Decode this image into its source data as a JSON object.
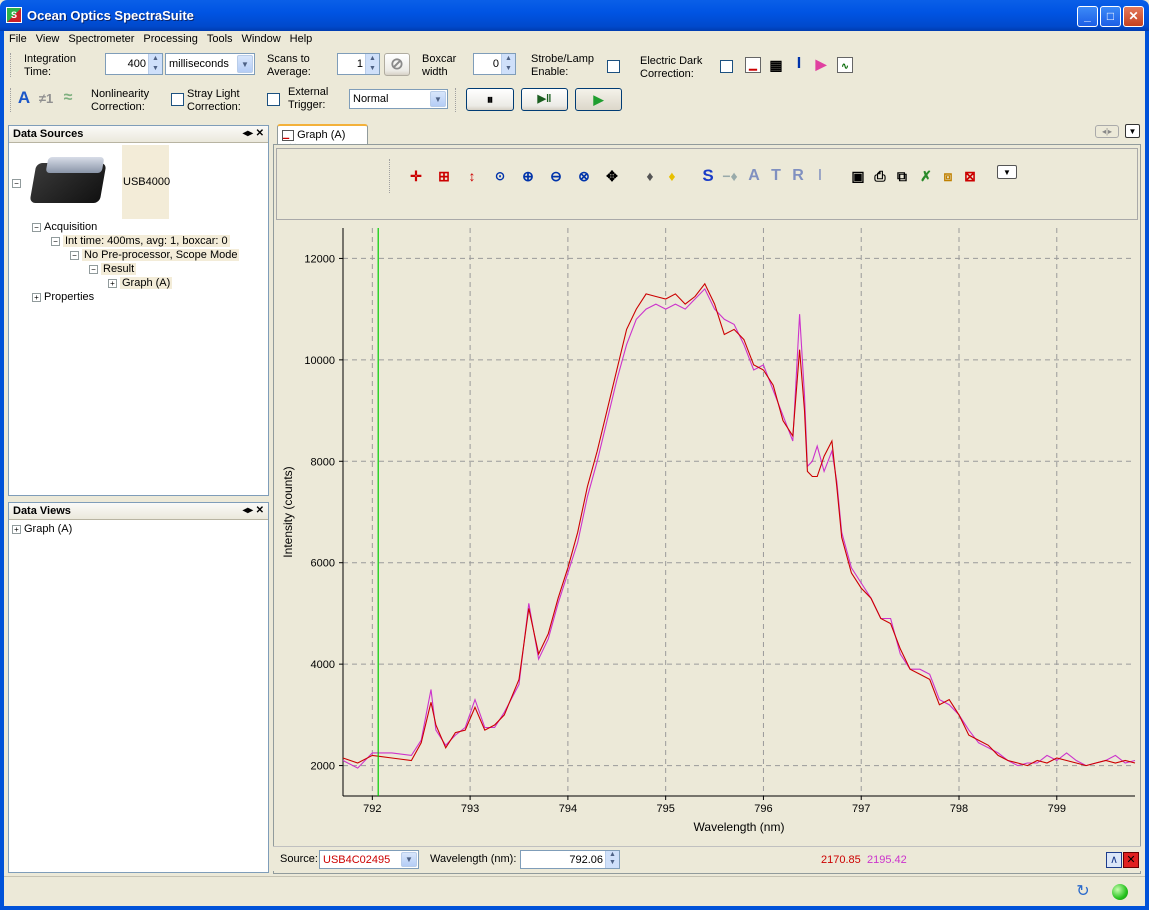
{
  "window": {
    "title": "Ocean Optics SpectraSuite",
    "minimize": "_",
    "maximize": "□",
    "close": "✕"
  },
  "menu": [
    "File",
    "View",
    "Spectrometer",
    "Processing",
    "Tools",
    "Window",
    "Help"
  ],
  "toolbar": {
    "integration_time_label1": "Integration",
    "integration_time_label2": "Time:",
    "integration_time_value": "400",
    "integration_unit": "milliseconds",
    "scans_label1": "Scans to",
    "scans_label2": "Average:",
    "scans_value": "1",
    "boxcar_label1": "Boxcar",
    "boxcar_label2": "width",
    "boxcar_value": "0",
    "strobe_label1": "Strobe/Lamp",
    "strobe_label2": "Enable:",
    "dark_label1": "Electric Dark",
    "dark_label2": "Correction:",
    "nonlin_label1": "Nonlinearity",
    "nonlin_label2": "Correction:",
    "stray_label1": "Stray Light",
    "stray_label2": "Correction:",
    "trigger_label1": "External",
    "trigger_label2": "Trigger:",
    "trigger_value": "Normal",
    "pause_icon": "⏸",
    "step_icon": "▶‖",
    "play_icon": "▶"
  },
  "data_sources": {
    "title": "Data Sources",
    "device": "USB4000",
    "acquisition": "Acquisition",
    "int_info": "Int time: 400ms, avg: 1, boxcar: 0",
    "preproc": "No Pre-processor, Scope Mode",
    "result": "Result",
    "graph": "Graph (A)",
    "properties": "Properties"
  },
  "data_views": {
    "title": "Data Views",
    "graph": "Graph (A)"
  },
  "graph_tab": {
    "label": "Graph (A)"
  },
  "status": {
    "source_label": "Source:",
    "source_value": "USB4C02495",
    "wavelength_label": "Wavelength (nm):",
    "wavelength_value": "792.06",
    "reading1": "2170.85",
    "reading2": "2195.42"
  },
  "colors": {
    "series_red": "#cc0000",
    "series_magenta": "#cc33cc",
    "cursor": "#00cc00",
    "plot_bg": "#ece9d8"
  },
  "chart_data": {
    "type": "line",
    "xlabel": "Wavelength (nm)",
    "ylabel": "Intensity (counts)",
    "xlim": [
      791.7,
      799.8
    ],
    "ylim": [
      1400,
      12600
    ],
    "xticks": [
      792,
      793,
      794,
      795,
      796,
      797,
      798,
      799
    ],
    "yticks": [
      2000,
      4000,
      6000,
      8000,
      10000,
      12000
    ],
    "grid": true,
    "cursor_x": 792.06,
    "series": [
      {
        "color": "#cc0000",
        "x": [
          791.7,
          791.85,
          792.0,
          792.2,
          792.4,
          792.5,
          792.6,
          792.65,
          792.75,
          792.85,
          792.95,
          793.05,
          793.15,
          793.25,
          793.35,
          793.5,
          793.6,
          793.7,
          793.8,
          793.9,
          794.0,
          794.1,
          794.2,
          794.3,
          794.4,
          794.5,
          794.6,
          794.7,
          794.8,
          794.9,
          795.0,
          795.1,
          795.2,
          795.3,
          795.4,
          795.5,
          795.6,
          795.7,
          795.8,
          795.9,
          796.0,
          796.1,
          796.2,
          796.3,
          796.37,
          796.42,
          796.45,
          796.5,
          796.55,
          796.62,
          796.7,
          796.75,
          796.8,
          796.9,
          797.0,
          797.1,
          797.2,
          797.3,
          797.4,
          797.5,
          797.6,
          797.7,
          797.8,
          797.9,
          798.0,
          798.1,
          798.2,
          798.3,
          798.4,
          798.5,
          798.6,
          798.7,
          798.8,
          798.9,
          799.0,
          799.1,
          799.2,
          799.3,
          799.4,
          799.5,
          799.6,
          799.7,
          799.8
        ],
        "values": [
          2150,
          2050,
          2200,
          2150,
          2100,
          2450,
          3250,
          2800,
          2350,
          2650,
          2700,
          3150,
          2700,
          2800,
          3000,
          3700,
          5100,
          4200,
          4600,
          5300,
          5900,
          6600,
          7500,
          8200,
          9000,
          9800,
          10600,
          11000,
          11300,
          11250,
          11200,
          11300,
          11100,
          11250,
          11500,
          11100,
          10500,
          10600,
          10400,
          9900,
          9800,
          9500,
          8800,
          8500,
          10200,
          9000,
          7800,
          7700,
          7700,
          8100,
          8400,
          7500,
          6500,
          5800,
          5500,
          5300,
          4900,
          4800,
          4300,
          3900,
          3800,
          3700,
          3200,
          3300,
          3000,
          2600,
          2500,
          2400,
          2200,
          2100,
          2050,
          2000,
          2100,
          2050,
          2150,
          2100,
          2050,
          2000,
          2050,
          2100,
          2050,
          2100,
          2050
        ]
      },
      {
        "color": "#cc33cc",
        "x": [
          791.7,
          791.85,
          792.0,
          792.2,
          792.4,
          792.5,
          792.6,
          792.65,
          792.75,
          792.85,
          792.95,
          793.05,
          793.15,
          793.25,
          793.35,
          793.5,
          793.6,
          793.7,
          793.8,
          793.9,
          794.0,
          794.1,
          794.2,
          794.3,
          794.4,
          794.5,
          794.6,
          794.7,
          794.8,
          794.9,
          795.0,
          795.1,
          795.2,
          795.3,
          795.4,
          795.5,
          795.6,
          795.7,
          795.8,
          795.9,
          796.0,
          796.1,
          796.2,
          796.3,
          796.37,
          796.42,
          796.45,
          796.5,
          796.55,
          796.62,
          796.7,
          796.75,
          796.8,
          796.9,
          797.0,
          797.1,
          797.2,
          797.3,
          797.4,
          797.5,
          797.6,
          797.7,
          797.8,
          797.9,
          798.0,
          798.1,
          798.2,
          798.3,
          798.4,
          798.5,
          798.6,
          798.7,
          798.8,
          798.9,
          799.0,
          799.1,
          799.2,
          799.3,
          799.4,
          799.5,
          799.6,
          799.7,
          799.8
        ],
        "values": [
          2100,
          1950,
          2250,
          2250,
          2200,
          2500,
          3500,
          2700,
          2400,
          2600,
          2750,
          3300,
          2750,
          2750,
          3050,
          3600,
          5200,
          4100,
          4500,
          5200,
          5800,
          6400,
          7300,
          8000,
          8800,
          9600,
          10300,
          10800,
          11000,
          11100,
          11000,
          11100,
          11000,
          11200,
          11400,
          11000,
          10800,
          10700,
          10300,
          9800,
          9900,
          9400,
          8900,
          8400,
          10900,
          9300,
          7900,
          8000,
          8300,
          7800,
          8200,
          7600,
          6600,
          5900,
          5600,
          5300,
          4900,
          4900,
          4200,
          3900,
          3900,
          3800,
          3300,
          3200,
          3000,
          2700,
          2450,
          2350,
          2250,
          2100,
          2000,
          2050,
          2050,
          2200,
          2100,
          2250,
          2100,
          2000,
          2050,
          2100,
          2200,
          2050,
          2100
        ]
      }
    ]
  }
}
